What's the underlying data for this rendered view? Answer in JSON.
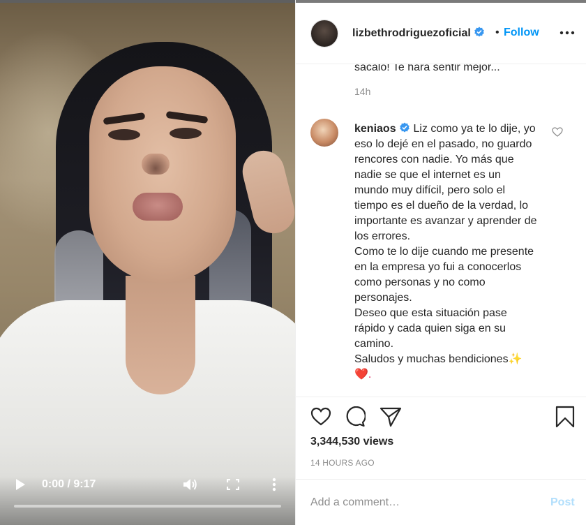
{
  "video": {
    "time_display": "0:00 / 9:17",
    "progress": 0.0,
    "icons": [
      "play-icon",
      "volume-icon",
      "fullscreen-icon",
      "more-vertical-icon"
    ]
  },
  "header": {
    "username": "lizbethrodriguezoficial",
    "verified": true,
    "separator": "•",
    "follow_label": "Follow",
    "more_icon": "more-horizontal-icon"
  },
  "previous_comment": {
    "text_tail": "sácalo! Te hará sentir mejor...",
    "time": "14h"
  },
  "comment": {
    "username": "keniaos",
    "verified": true,
    "lines": [
      "Liz como ya te lo dije, yo eso lo dejé en el pasado, no guardo rencores con nadie. Yo más que nadie se que el internet es un mundo muy difícil, pero solo el tiempo es el dueño de la verdad, lo importante es avanzar y aprender de los errores.",
      "Como te lo dije cuando me presente en la empresa yo fui a conocerlos como personas y no como personajes.",
      "Deseo que esta situación pase rápido y cada quien siga en su camino.",
      "Saludos y muchas bendiciones✨",
      "❤️."
    ]
  },
  "actions": {
    "icons": [
      "heart-icon",
      "comment-icon",
      "share-icon",
      "bookmark-icon"
    ],
    "views": "3,344,530 views",
    "time_ago": "14 HOURS AGO"
  },
  "add_comment": {
    "placeholder": "Add a comment…",
    "post_label": "Post"
  },
  "colors": {
    "accent": "#0095f6",
    "post_disabled": "#b2dffc",
    "muted_text": "#8e8e8e"
  }
}
